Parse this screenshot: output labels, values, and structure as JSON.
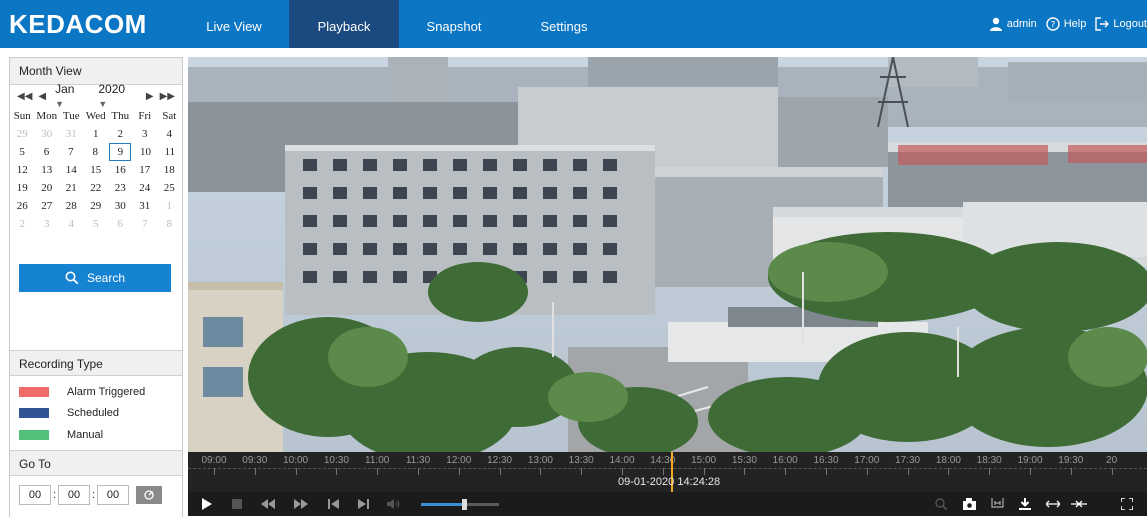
{
  "brand": {
    "logo": "KEDACOM"
  },
  "nav": [
    {
      "label": "Live View"
    },
    {
      "label": "Playback"
    },
    {
      "label": "Snapshot"
    },
    {
      "label": "Settings"
    }
  ],
  "nav_active": "Playback",
  "user": {
    "name": "admin",
    "help": "Help",
    "logout": "Logout"
  },
  "calendar": {
    "title": "Month View",
    "month": "Jan",
    "year": "2020",
    "weekdays": [
      "Sun",
      "Mon",
      "Tue",
      "Wed",
      "Thu",
      "Fri",
      "Sat"
    ],
    "weeks": [
      [
        "29",
        "30",
        "31",
        "1",
        "2",
        "3",
        "4"
      ],
      [
        "5",
        "6",
        "7",
        "8",
        "9",
        "10",
        "11"
      ],
      [
        "12",
        "13",
        "14",
        "15",
        "16",
        "17",
        "18"
      ],
      [
        "19",
        "20",
        "21",
        "22",
        "23",
        "24",
        "25"
      ],
      [
        "26",
        "27",
        "28",
        "29",
        "30",
        "31",
        "1"
      ],
      [
        "2",
        "3",
        "4",
        "5",
        "6",
        "7",
        "8"
      ]
    ],
    "selected_day": "9",
    "search_label": "Search"
  },
  "recording_type": {
    "title": "Recording Type",
    "items": [
      {
        "label": "Alarm Triggered",
        "color": "#f26b6b"
      },
      {
        "label": "Scheduled",
        "color": "#2f5597"
      },
      {
        "label": "Manual",
        "color": "#53c07a"
      }
    ]
  },
  "goto": {
    "title": "Go To",
    "hh": "00",
    "mm": "00",
    "ss": "00"
  },
  "timeline": {
    "labels": [
      "09:00",
      "09:30",
      "10:00",
      "10:30",
      "11:00",
      "11:30",
      "12:00",
      "12:30",
      "13:00",
      "13:30",
      "14:00",
      "14:30",
      "15:00",
      "15:30",
      "16:00",
      "16:30",
      "17:00",
      "17:30",
      "18:00",
      "18:30",
      "19:00",
      "19:30",
      "20"
    ],
    "current_time": "09-01-2020 14:24:28",
    "cursor_color": "#f5a623"
  },
  "volume": {
    "level": 0.55
  },
  "colors": {
    "topbar": "#0b76c4",
    "nav_active": "#1a4a7f",
    "accent": "#1583d2"
  }
}
